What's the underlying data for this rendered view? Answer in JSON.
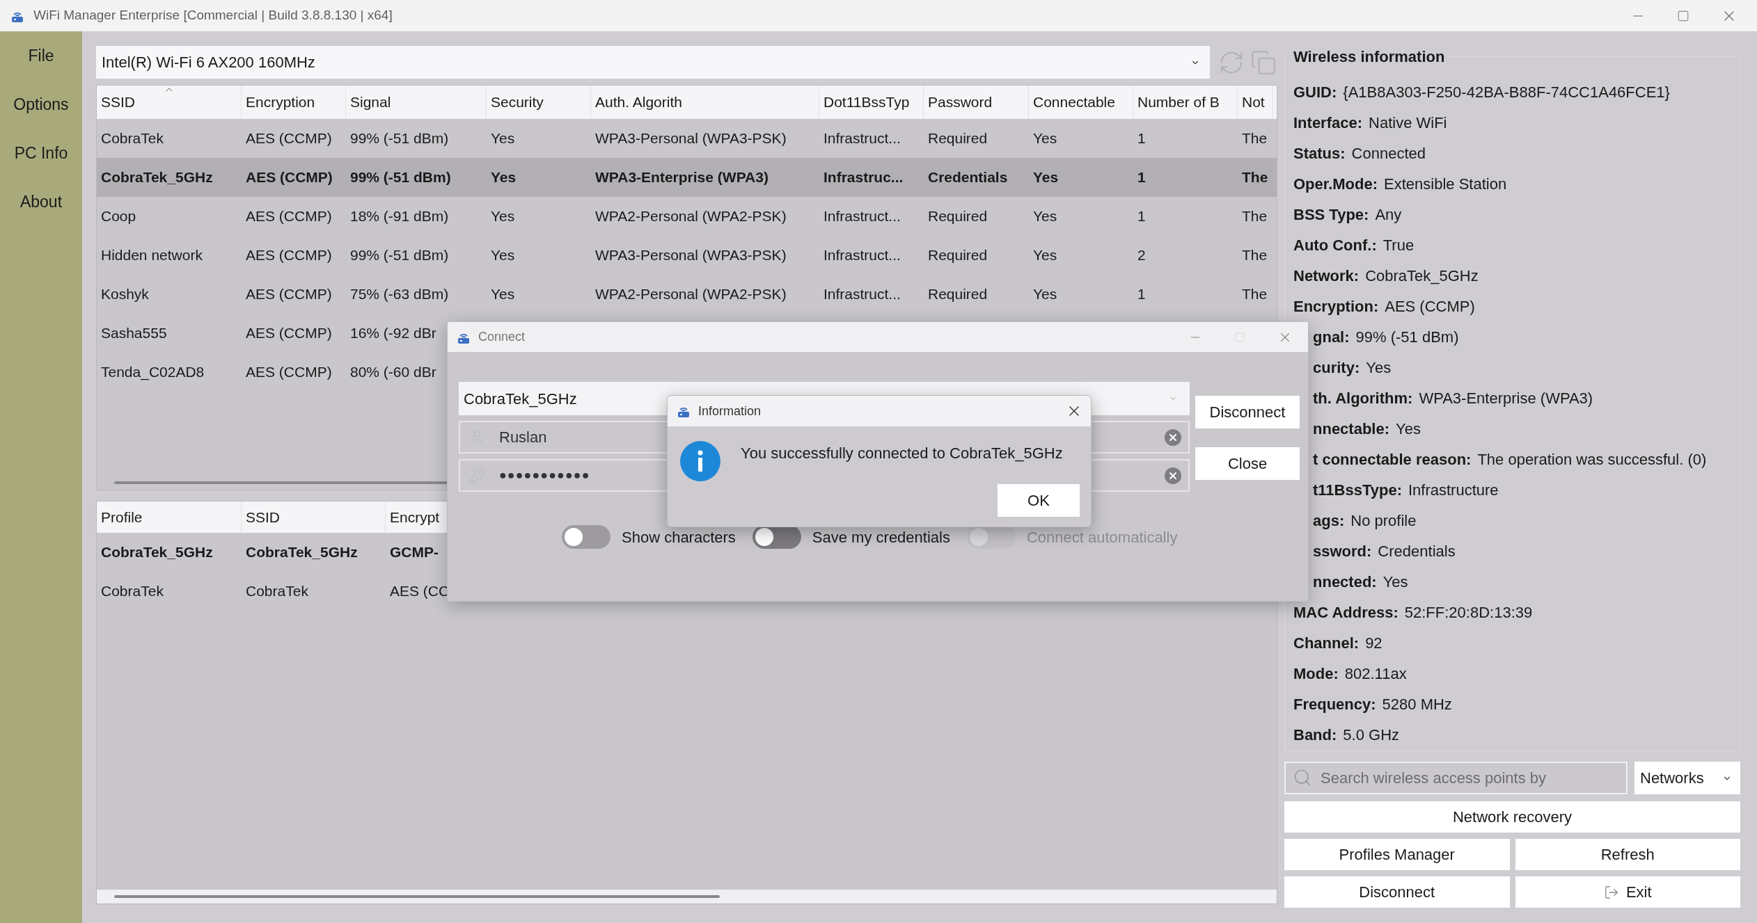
{
  "window": {
    "title": "WiFi Manager Enterprise [Commercial | Build 3.8.8.130 | x64]"
  },
  "sidebar": {
    "items": [
      "File",
      "Options",
      "PC Info",
      "About"
    ]
  },
  "adapter": {
    "value": "Intel(R) Wi-Fi 6 AX200 160MHz"
  },
  "networks_table": {
    "columns": [
      {
        "label": "SSID",
        "sorted": true
      },
      {
        "label": "Encryption",
        "sorted": false
      },
      {
        "label": "Signal",
        "sorted": false
      },
      {
        "label": "Security",
        "sorted": false
      },
      {
        "label": "Auth. Algorith",
        "sorted": false
      },
      {
        "label": "Dot11BssTyp",
        "sorted": false
      },
      {
        "label": "Password",
        "sorted": false
      },
      {
        "label": "Connectable",
        "sorted": false
      },
      {
        "label": "Number of B",
        "sorted": false
      },
      {
        "label": "Not",
        "sorted": false
      }
    ],
    "rows": [
      {
        "selected": false,
        "cells": [
          "CobraTek",
          "AES (CCMP)",
          "99% (-51 dBm)",
          "Yes",
          "WPA3-Personal (WPA3-PSK)",
          "Infrastruct...",
          "Required",
          "Yes",
          "1",
          "The"
        ]
      },
      {
        "selected": true,
        "cells": [
          "CobraTek_5GHz",
          "AES (CCMP)",
          "99% (-51 dBm)",
          "Yes",
          "WPA3-Enterprise (WPA3)",
          "Infrastruc...",
          "Credentials",
          "Yes",
          "1",
          "The"
        ]
      },
      {
        "selected": false,
        "cells": [
          "Coop",
          "AES (CCMP)",
          "18% (-91 dBm)",
          "Yes",
          "WPA2-Personal (WPA2-PSK)",
          "Infrastruct...",
          "Required",
          "Yes",
          "1",
          "The"
        ]
      },
      {
        "selected": false,
        "cells": [
          "Hidden network",
          "AES (CCMP)",
          "99% (-51 dBm)",
          "Yes",
          "WPA3-Personal (WPA3-PSK)",
          "Infrastruct...",
          "Required",
          "Yes",
          "2",
          "The"
        ]
      },
      {
        "selected": false,
        "cells": [
          "Koshyk",
          "AES (CCMP)",
          "75% (-63 dBm)",
          "Yes",
          "WPA2-Personal (WPA2-PSK)",
          "Infrastruct...",
          "Required",
          "Yes",
          "1",
          "The"
        ]
      },
      {
        "selected": false,
        "cells": [
          "Sasha555",
          "AES (CCMP)",
          "16% (-92 dBr"
        ]
      },
      {
        "selected": false,
        "cells": [
          "Tenda_C02AD8",
          "AES (CCMP)",
          "80% (-60 dBr"
        ]
      }
    ]
  },
  "profiles_table": {
    "columns": [
      "Profile",
      "SSID",
      "Encrypt"
    ],
    "rows": [
      {
        "selected": true,
        "cells": [
          "CobraTek_5GHz",
          "CobraTek_5GHz",
          "GCMP-"
        ]
      },
      {
        "selected": false,
        "cells": [
          "CobraTek",
          "CobraTek",
          "AES (CC"
        ]
      }
    ]
  },
  "wireless_info": {
    "title": "Wireless information",
    "rows": [
      {
        "kind": "full",
        "label": "GUID:",
        "value": "{A1B8A303-F250-42BA-B88F-74CC1A46FCE1}"
      },
      {
        "kind": "full",
        "label": "Interface:",
        "value": "Native WiFi"
      },
      {
        "kind": "full",
        "label": "Status:",
        "value": "Connected"
      },
      {
        "kind": "full",
        "label": "Oper.Mode:",
        "value": "Extensible Station"
      },
      {
        "kind": "full",
        "label": "BSS Type:",
        "value": "Any"
      },
      {
        "kind": "full",
        "label": "Auto Conf.:",
        "value": "True"
      },
      {
        "kind": "full",
        "label": "Network:",
        "value": "CobraTek_5GHz"
      },
      {
        "kind": "full",
        "label": "Encryption:",
        "value": "AES (CCMP)"
      },
      {
        "kind": "clipped",
        "label": "gnal:",
        "value": "99% (-51 dBm)"
      },
      {
        "kind": "clipped",
        "label": "curity:",
        "value": "Yes"
      },
      {
        "kind": "clipped",
        "label": "th. Algorithm:",
        "value": "WPA3-Enterprise (WPA3)"
      },
      {
        "kind": "clipped",
        "label": "nnectable:",
        "value": "Yes"
      },
      {
        "kind": "clipped",
        "label": "t connectable reason:",
        "value": "The operation was successful. (0)"
      },
      {
        "kind": "clipped",
        "label": "t11BssType:",
        "value": "Infrastructure"
      },
      {
        "kind": "clipped",
        "label": "ags:",
        "value": "No profile"
      },
      {
        "kind": "clipped",
        "label": "ssword:",
        "value": "Credentials"
      },
      {
        "kind": "clipped",
        "label": "nnected:",
        "value": "Yes"
      },
      {
        "kind": "full",
        "label": "MAC Address:",
        "value": "52:FF:20:8D:13:39"
      },
      {
        "kind": "full",
        "label": "Channel:",
        "value": "92"
      },
      {
        "kind": "full",
        "label": "Mode:",
        "value": "802.11ax"
      },
      {
        "kind": "full",
        "label": "Frequency:",
        "value": "5280 MHz"
      },
      {
        "kind": "full",
        "label": "Band:",
        "value": "5.0 GHz"
      }
    ]
  },
  "search": {
    "placeholder": "Search wireless access points by"
  },
  "search_scope": {
    "value": "Networks"
  },
  "buttons": [
    {
      "kind": "plain",
      "label": "Network recovery"
    },
    {
      "kind": "plain",
      "label": "Profiles Manager"
    },
    {
      "kind": "plain",
      "label": "Refresh"
    },
    {
      "kind": "plain",
      "label": "Disconnect"
    },
    {
      "kind": "exit",
      "label": "Exit"
    }
  ],
  "connect_dialog": {
    "title": "Connect",
    "network": "CobraTek_5GHz",
    "username": "Ruslan",
    "password": "●●●●●●●●●●●",
    "buttons": [
      "Disconnect",
      "Close"
    ],
    "toggles": [
      {
        "label": "Show characters",
        "on": false,
        "disabled": false
      },
      {
        "label": "Save my credentials",
        "on": false,
        "disabled": false
      },
      {
        "label": "Connect automatically",
        "on": false,
        "disabled": true
      }
    ]
  },
  "info_dialog": {
    "title": "Information",
    "message": "You successfully connected to CobraTek_5GHz",
    "button": "OK"
  }
}
